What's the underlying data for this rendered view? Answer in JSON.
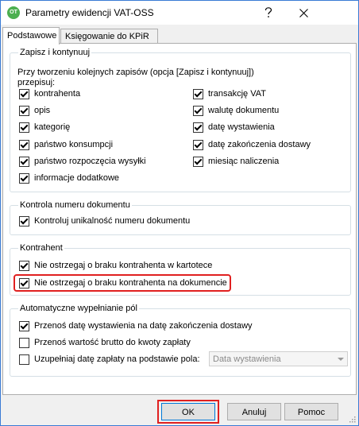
{
  "window": {
    "title": "Parametry ewidencji VAT-OSS",
    "icon_text": "OT"
  },
  "tabs": [
    {
      "label": "Podstawowe",
      "active": true
    },
    {
      "label": "Księgowanie do KPiR",
      "active": false
    }
  ],
  "save_group": {
    "title": "Zapisz i kontynuuj",
    "hint_line1": "Przy tworzeniu kolejnych zapisów (opcja [Zapisz i kontynuuj])",
    "hint_line2": "przepisuj:",
    "left_items": [
      {
        "label": "kontrahenta",
        "checked": true
      },
      {
        "label": "opis",
        "checked": true
      },
      {
        "label": "kategorię",
        "checked": true
      },
      {
        "label": "państwo konsumpcji",
        "checked": true
      },
      {
        "label": "państwo rozpoczęcia wysyłki",
        "checked": true
      },
      {
        "label": "informacje dodatkowe",
        "checked": true
      }
    ],
    "right_items": [
      {
        "label": "transakcję VAT",
        "checked": true
      },
      {
        "label": "walutę dokumentu",
        "checked": true
      },
      {
        "label": "datę wystawienia",
        "checked": true
      },
      {
        "label": "datę zakończenia dostawy",
        "checked": true
      },
      {
        "label": "miesiąc naliczenia",
        "checked": true
      }
    ]
  },
  "doc_number_group": {
    "title": "Kontrola numeru dokumentu",
    "items": [
      {
        "label": "Kontroluj unikalność numeru dokumentu",
        "checked": true
      }
    ]
  },
  "contractor_group": {
    "title": "Kontrahent",
    "items": [
      {
        "label": "Nie ostrzegaj o braku kontrahenta w kartotece",
        "checked": true
      },
      {
        "label": "Nie ostrzegaj o braku kontrahenta na dokumencie",
        "checked": true
      }
    ]
  },
  "autofill_group": {
    "title": "Automatyczne wypełnianie pól",
    "items": [
      {
        "label": "Przenoś datę wystawienia na datę zakończenia dostawy",
        "checked": true
      },
      {
        "label": "Przenoś wartość brutto do kwoty zapłaty",
        "checked": false
      },
      {
        "label": "Uzupełniaj datę zapłaty na podstawie pola:",
        "checked": false
      }
    ],
    "select_value": "Data wystawienia"
  },
  "buttons": {
    "ok": "OK",
    "cancel": "Anuluj",
    "help": "Pomoc"
  },
  "colors": {
    "highlight": "#e02020",
    "accent": "#0078d7"
  }
}
